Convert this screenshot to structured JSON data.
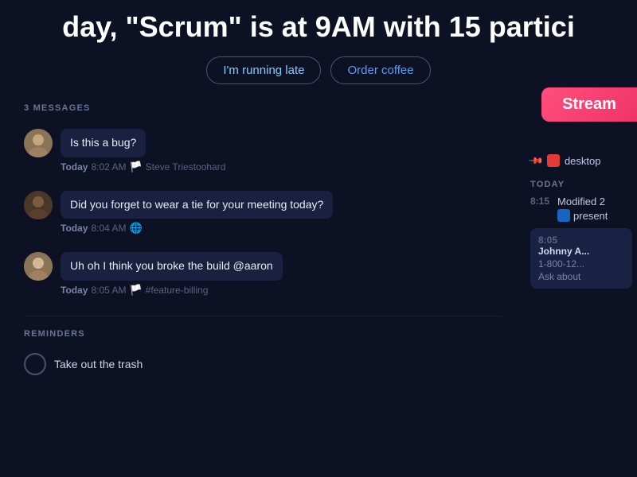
{
  "banner": {
    "title": "day, \"Scrum\" is at 9AM with 15 partici",
    "btn_late": "I'm running late",
    "btn_coffee": "Order coffee"
  },
  "messages": {
    "section_label": "3 MESSAGES",
    "items": [
      {
        "id": 1,
        "avatar_label": "ST",
        "text": "Is this a bug?",
        "time_label": "Today",
        "time": "8:02 AM",
        "channel": "Steve Triestoohard",
        "emoji": "🏳️"
      },
      {
        "id": 2,
        "avatar_label": "U2",
        "text": "Did you forget to wear a tie for your meeting today?",
        "time_label": "Today",
        "time": "8:04 AM",
        "channel": "",
        "emoji": "🌐"
      },
      {
        "id": 3,
        "avatar_label": "U3",
        "text": "Uh oh I think you broke the build @aaron",
        "time_label": "Today",
        "time": "8:05 AM",
        "channel": "#feature-billing",
        "emoji": "🏳️"
      }
    ]
  },
  "reminders": {
    "section_label": "REMINDERS",
    "items": [
      {
        "text": "Take out the trash"
      }
    ]
  },
  "right_panel": {
    "stream_label": "Stream",
    "pinned_items": [
      {
        "label": "desktop",
        "app": "red"
      }
    ],
    "today_label": "TODAY",
    "today_items": [
      {
        "time": "8:15",
        "text": "Modified 2",
        "app": "blue",
        "app_label": "present"
      }
    ],
    "notification": {
      "time": "8:05",
      "title": "Johnny A...",
      "phone": "1-800-12...",
      "body": "Ask about"
    }
  }
}
